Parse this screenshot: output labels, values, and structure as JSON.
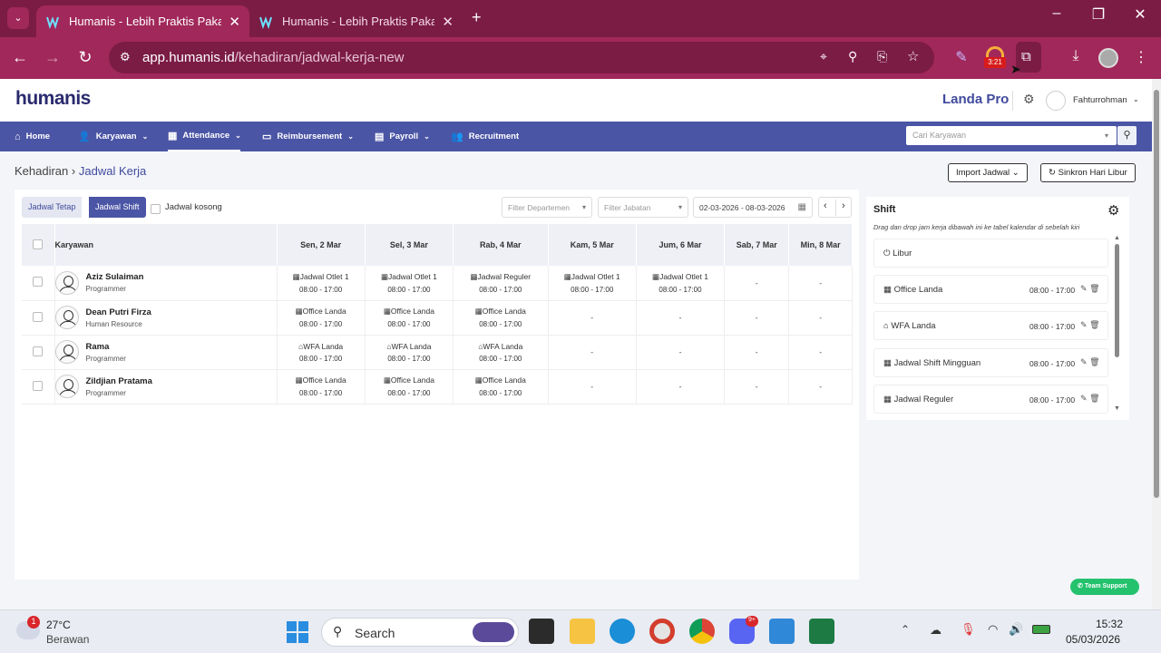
{
  "browser": {
    "tabs": [
      {
        "title": "Humanis - Lebih Praktis Pakai H",
        "active": true
      },
      {
        "title": "Humanis - Lebih Praktis Pakai H",
        "active": false
      }
    ],
    "url_host": "app.humanis.id",
    "url_path": "/kehadiran/jadwal-kerja-new",
    "extension_badge": "3:21"
  },
  "header": {
    "logo": "humanis",
    "company": "Landa Pro",
    "user": "Fahturrohman"
  },
  "menu": {
    "items": [
      {
        "label": "Home",
        "icon": "home-icon"
      },
      {
        "label": "Karyawan",
        "icon": "user-plus-icon"
      },
      {
        "label": "Attendance",
        "icon": "calendar-icon"
      },
      {
        "label": "Reimbursement",
        "icon": "money-icon"
      },
      {
        "label": "Payroll",
        "icon": "file-icon"
      },
      {
        "label": "Recruitment",
        "icon": "users-icon"
      }
    ],
    "search_placeholder": "Cari Karyawan"
  },
  "page": {
    "crumb_parent": "Kehadiran",
    "crumb_current": "Jadwal Kerja",
    "import_label": "Import Jadwal",
    "sync_label": "Sinkron Hari Libur"
  },
  "schedule": {
    "toggle_fixed": "Jadwal Tetap",
    "toggle_shift": "Jadwal Shift",
    "empty_label": "Jadwal kosong",
    "filter_dept": "Filter Departemen",
    "filter_position": "Filter Jabatan",
    "date_range": "02-03-2026 - 08-03-2026",
    "col_employee": "Karyawan",
    "days": [
      "Sen, 2 Mar",
      "Sel, 3 Mar",
      "Rab, 4 Mar",
      "Kam, 5 Mar",
      "Jum, 6 Mar",
      "Sab, 7 Mar",
      "Min, 8 Mar"
    ],
    "rows": [
      {
        "name": "Aziz Sulaiman",
        "role": "Programmer",
        "cells": [
          [
            "Jadwal Otlet 1",
            "08:00 - 17:00",
            "building"
          ],
          [
            "Jadwal Otlet 1",
            "08:00 - 17:00",
            "building"
          ],
          [
            "Jadwal Reguler",
            "08:00 - 17:00",
            "building"
          ],
          [
            "Jadwal Otlet 1",
            "08:00 - 17:00",
            "building"
          ],
          [
            "Jadwal Otlet 1",
            "08:00 - 17:00",
            "building"
          ],
          [
            "-",
            "",
            ""
          ],
          [
            "-",
            "",
            ""
          ]
        ]
      },
      {
        "name": "Dean Putri Firza",
        "role": "Human Resource",
        "cells": [
          [
            "Office Landa",
            "08:00 - 17:00",
            "building"
          ],
          [
            "Office Landa",
            "08:00 - 17:00",
            "building"
          ],
          [
            "Office Landa",
            "08:00 - 17:00",
            "building"
          ],
          [
            "-",
            "",
            ""
          ],
          [
            "-",
            "",
            ""
          ],
          [
            "-",
            "",
            ""
          ],
          [
            "-",
            "",
            ""
          ]
        ]
      },
      {
        "name": "Rama",
        "role": "Programmer",
        "cells": [
          [
            "WFA Landa",
            "08:00 - 17:00",
            "home"
          ],
          [
            "WFA Landa",
            "08:00 - 17:00",
            "home"
          ],
          [
            "WFA Landa",
            "08:00 - 17:00",
            "home"
          ],
          [
            "-",
            "",
            ""
          ],
          [
            "-",
            "",
            ""
          ],
          [
            "-",
            "",
            ""
          ],
          [
            "-",
            "",
            ""
          ]
        ]
      },
      {
        "name": "Zildjian Pratama",
        "role": "Programmer",
        "cells": [
          [
            "Office Landa",
            "08:00 - 17:00",
            "building"
          ],
          [
            "Office Landa",
            "08:00 - 17:00",
            "building"
          ],
          [
            "Office Landa",
            "08:00 - 17:00",
            "building"
          ],
          [
            "-",
            "",
            ""
          ],
          [
            "-",
            "",
            ""
          ],
          [
            "-",
            "",
            ""
          ],
          [
            "-",
            "",
            ""
          ]
        ]
      }
    ]
  },
  "shift_panel": {
    "title": "Shift",
    "desc": "Drag dan drop jam kerja dibawah ini ke tabel kalendar di sebelah kiri",
    "holiday": "Libur",
    "items": [
      {
        "name": "Office Landa",
        "time": "08:00 - 17:00",
        "icon": "building"
      },
      {
        "name": "WFA Landa",
        "time": "08:00 - 17:00",
        "icon": "home"
      },
      {
        "name": "Jadwal Shift Mingguan",
        "time": "08:00 - 17:00",
        "icon": "building"
      },
      {
        "name": "Jadwal Reguler",
        "time": "08:00 - 17:00",
        "icon": "building"
      }
    ]
  },
  "support_label": "Team Support",
  "taskbar": {
    "temp": "27°C",
    "weather": "Berawan",
    "weather_badge": "1",
    "search": "Search",
    "time": "15:32",
    "date": "05/03/2026",
    "discord_badge": "9+"
  }
}
